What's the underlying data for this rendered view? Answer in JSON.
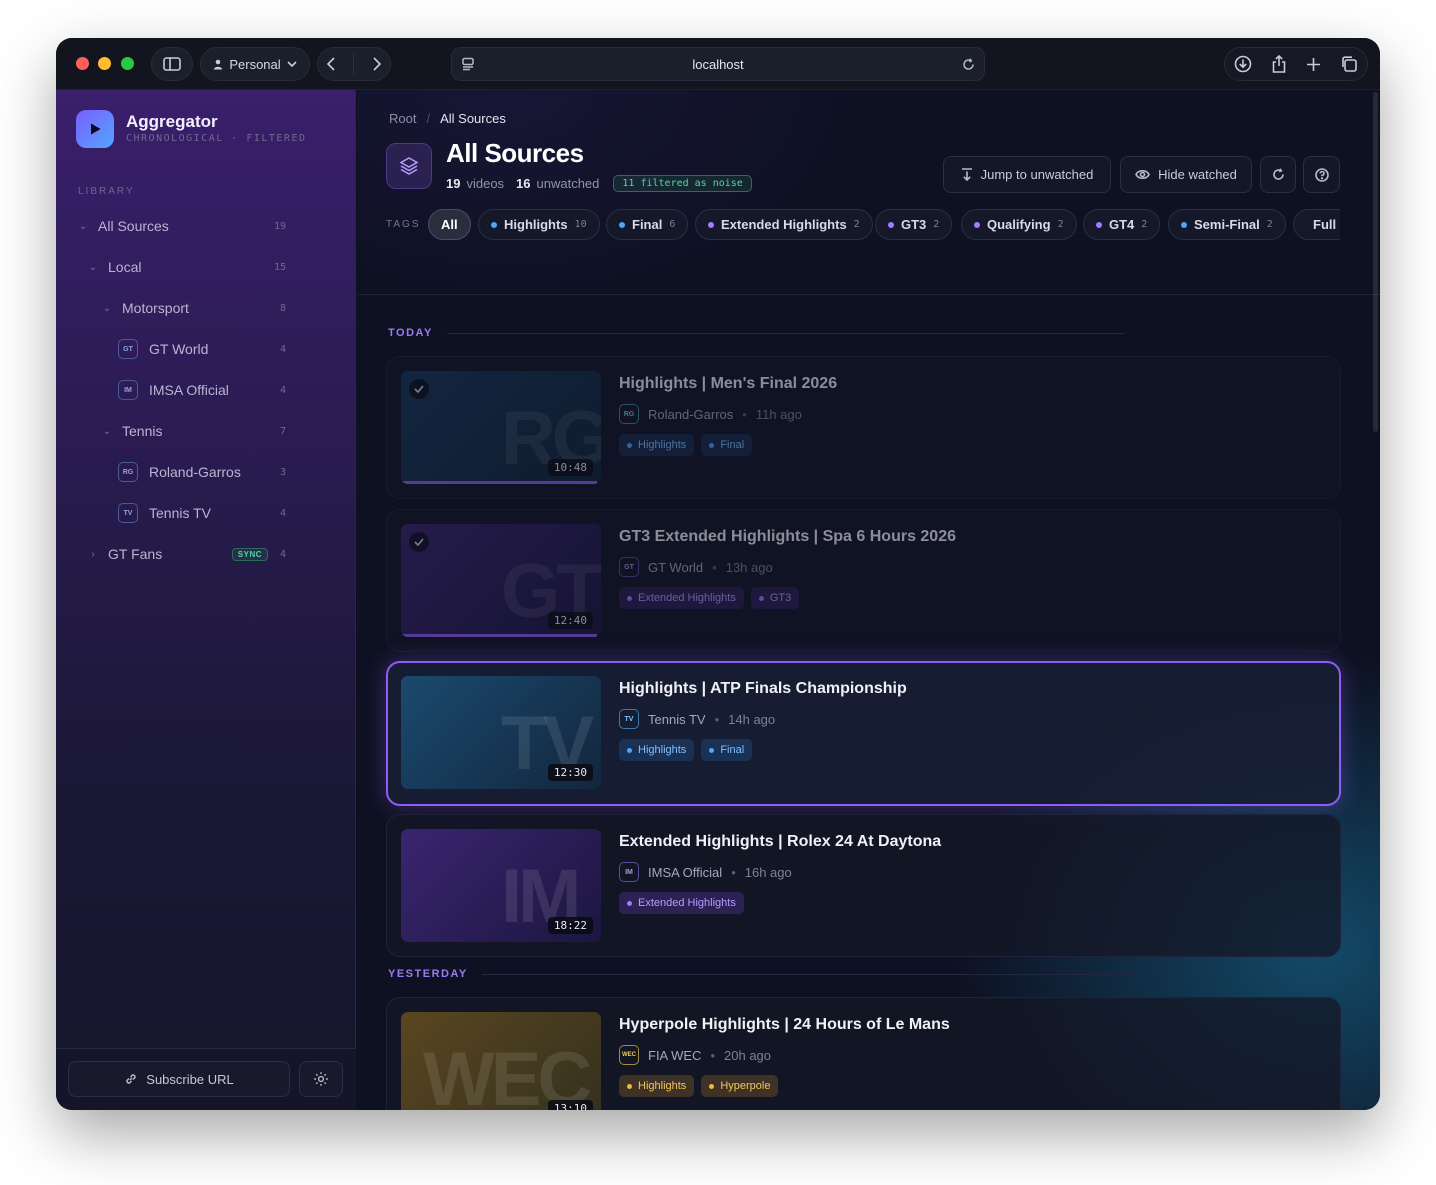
{
  "browser": {
    "profile_label": "Personal",
    "url": "localhost"
  },
  "sidebar": {
    "brand_title": "Aggregator",
    "brand_subtitle": "CHRONOLOGICAL · FILTERED",
    "library_label": "LIBRARY",
    "items": [
      {
        "label": "All Sources",
        "count": "19"
      },
      {
        "label": "Local",
        "count": "15"
      },
      {
        "label": "Motorsport",
        "count": "8"
      },
      {
        "label": "GT World",
        "count": "4",
        "badge": "GT"
      },
      {
        "label": "IMSA Official",
        "count": "4",
        "badge": "IM"
      },
      {
        "label": "Tennis",
        "count": "7"
      },
      {
        "label": "Roland-Garros",
        "count": "3",
        "badge": "RG"
      },
      {
        "label": "Tennis TV",
        "count": "4",
        "badge": "TV"
      },
      {
        "label": "GT Fans",
        "count": "4",
        "sync": "SYNC"
      }
    ],
    "subscribe_label": "Subscribe URL"
  },
  "main": {
    "breadcrumb_root": "Root",
    "breadcrumb_sep": "/",
    "breadcrumb_current": "All Sources",
    "title": "All Sources",
    "videos_count": "19",
    "videos_label": "videos",
    "unwatched_count": "16",
    "unwatched_label": "unwatched",
    "noise_badge": "11 filtered as noise",
    "jump_label": "Jump to unwatched",
    "hide_label": "Hide watched",
    "tags_label": "TAGS",
    "tags": [
      {
        "label": "All"
      },
      {
        "label": "Highlights",
        "count": "10",
        "color": "#4aa6ff"
      },
      {
        "label": "Final",
        "count": "6",
        "color": "#4aa6ff"
      },
      {
        "label": "Extended Highlights",
        "count": "2",
        "color": "#a27bff"
      },
      {
        "label": "GT3",
        "count": "2",
        "color": "#a27bff"
      },
      {
        "label": "Qualifying",
        "count": "2",
        "color": "#a27bff"
      },
      {
        "label": "GT4",
        "count": "2",
        "color": "#a27bff"
      },
      {
        "label": "Semi-Final",
        "count": "2",
        "color": "#4aa6ff"
      },
      {
        "label": "Full",
        "color": "#a27bff"
      }
    ],
    "sections": {
      "today": "TODAY",
      "yesterday": "YESTERDAY"
    },
    "videos": [
      {
        "title": "Highlights | Men's Final 2026",
        "source": "Roland-Garros",
        "source_badge": "RG",
        "ago": "11h ago",
        "duration": "10:48",
        "thumb_text": "RG",
        "tags": [
          "Highlights",
          "Final"
        ],
        "watched": true
      },
      {
        "title": "GT3 Extended Highlights | Spa 6 Hours 2026",
        "source": "GT World",
        "source_badge": "GT",
        "ago": "13h ago",
        "duration": "12:40",
        "thumb_text": "GT",
        "tags": [
          "Extended Highlights",
          "GT3"
        ],
        "watched": true
      },
      {
        "title": "Highlights | ATP Finals Championship",
        "source": "Tennis TV",
        "source_badge": "TV",
        "ago": "14h ago",
        "duration": "12:30",
        "thumb_text": "TV",
        "tags": [
          "Highlights",
          "Final"
        ],
        "watched": false
      },
      {
        "title": "Extended Highlights | Rolex 24 At Daytona",
        "source": "IMSA Official",
        "source_badge": "IM",
        "ago": "16h ago",
        "duration": "18:22",
        "thumb_text": "IM",
        "tags": [
          "Extended Highlights"
        ],
        "watched": false
      },
      {
        "title": "Hyperpole Highlights | 24 Hours of Le Mans",
        "source": "FIA WEC",
        "source_badge": "WEC",
        "ago": "20h ago",
        "duration": "13:10",
        "thumb_text": "WEC",
        "tags": [
          "Highlights",
          "Hyperpole"
        ],
        "watched": false
      }
    ]
  },
  "colors": {
    "accent": "#8f5cf6",
    "blue_tag": "#4aa6ff",
    "purple_tag": "#a27bff",
    "gold_tag": "#f0b83a",
    "noise_green": "#53d6a0"
  }
}
